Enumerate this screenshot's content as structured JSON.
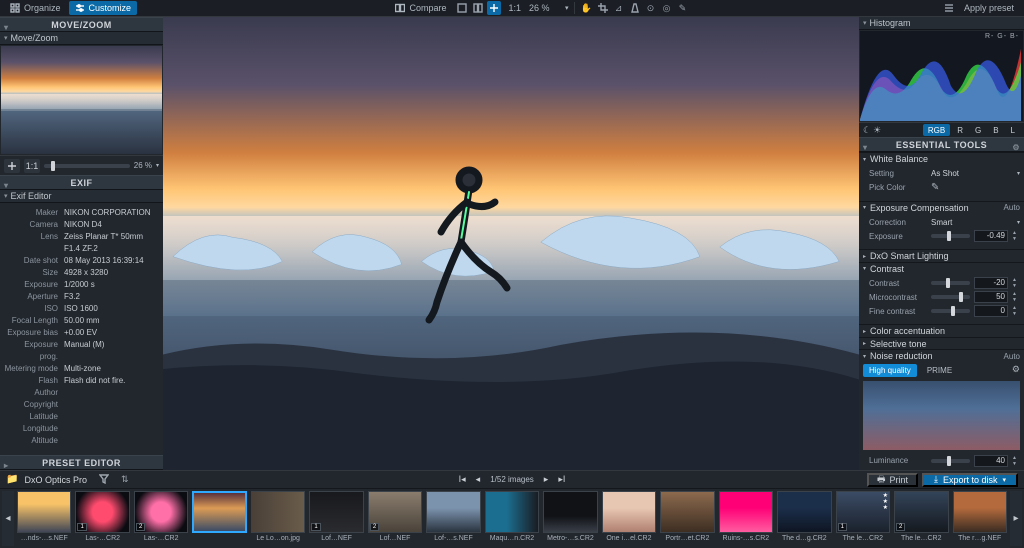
{
  "topbar": {
    "organize_label": "Organize",
    "customize_label": "Customize",
    "compare_label": "Compare",
    "zoom_fit_label": "1:1",
    "zoom_pct": "26 %",
    "apply_preset_label": "Apply preset"
  },
  "left": {
    "move_zoom_hdr": "MOVE/ZOOM",
    "zoom_row": {
      "one_to_one": "1:1",
      "pct": "26 %"
    },
    "exif_hdr": "EXIF",
    "exif_editor_hdr": "Exif Editor",
    "exif": {
      "maker_l": "Maker",
      "maker_v": "NIKON CORPORATION",
      "camera_l": "Camera",
      "camera_v": "NIKON D4",
      "lens_l": "Lens",
      "lens_v": "Zeiss Planar T* 50mm F1.4 ZF.2",
      "dateshot_l": "Date shot",
      "dateshot_v": "08 May 2013 16:39:14",
      "size_l": "Size",
      "size_v": "4928 x 3280",
      "exposure_l": "Exposure",
      "exposure_v": "1/2000 s",
      "aperture_l": "Aperture",
      "aperture_v": "F3.2",
      "iso_l": "ISO",
      "iso_v": "ISO 1600",
      "focallen_l": "Focal Length",
      "focallen_v": "50.00 mm",
      "expbias_l": "Exposure bias",
      "expbias_v": "+0.00 EV",
      "expprog_l": "Exposure prog.",
      "expprog_v": "Manual (M)",
      "metering_l": "Metering mode",
      "metering_v": "Multi-zone",
      "flash_l": "Flash",
      "flash_v": "Flash did not fire.",
      "author_l": "Author",
      "author_v": "",
      "copyright_l": "Copyright",
      "copyright_v": "",
      "latitude_l": "Latitude",
      "latitude_v": "",
      "longitude_l": "Longitude",
      "longitude_v": "",
      "altitude_l": "Altitude",
      "altitude_v": ""
    },
    "preset_editor_hdr": "PRESET EDITOR"
  },
  "right": {
    "histogram_hdr": "Histogram",
    "histo_legend": "R- G- B-",
    "channels": {
      "rgb": "RGB",
      "r": "R",
      "g": "G",
      "b": "B",
      "l": "L"
    },
    "essential_hdr": "ESSENTIAL TOOLS",
    "wb": {
      "title": "White Balance",
      "setting_l": "Setting",
      "setting_v": "As Shot",
      "pick_l": "Pick Color"
    },
    "expcomp": {
      "title": "Exposure Compensation",
      "auto": "Auto",
      "correction_l": "Correction",
      "correction_v": "Smart",
      "exposure_l": "Exposure",
      "exposure_v": "-0.49"
    },
    "smartlight": {
      "title": "DxO Smart Lighting"
    },
    "contrast": {
      "title": "Contrast",
      "contrast_l": "Contrast",
      "contrast_v": "-20",
      "micro_l": "Microcontrast",
      "micro_v": "50",
      "fine_l": "Fine contrast",
      "fine_v": "0"
    },
    "color_acc": {
      "title": "Color accentuation"
    },
    "sel_tone": {
      "title": "Selective tone"
    },
    "noise": {
      "title": "Noise reduction",
      "auto": "Auto",
      "hq": "High quality",
      "prime": "PRIME",
      "luminance_l": "Luminance",
      "luminance_v": "40"
    }
  },
  "bottom": {
    "folder_path": "DxO Optics Pro",
    "counter": "1/52 images",
    "print_label": "Print",
    "export_label": "Export to disk",
    "thumbs": [
      {
        "cap": "…nds-…s.NEF",
        "badge": "",
        "sel": false,
        "bg": "linear-gradient(#f8c368 30%,#404656 100%)"
      },
      {
        "cap": "Las-…CR2",
        "badge": "1",
        "sel": false,
        "bg": "radial-gradient(circle,#ff4b6e 30%,#0b0c12 80%)"
      },
      {
        "cap": "Las-…CR2",
        "badge": "2",
        "sel": false,
        "bg": "radial-gradient(circle,#ff6fa8 30%,#0b0c12 80%)"
      },
      {
        "cap": "",
        "badge": "",
        "sel": true,
        "bg": "linear-gradient(#58313b 0%,#dc9b55 40%,#3b4c66 100%)"
      },
      {
        "cap": "Le Lo…on.jpg",
        "badge": "",
        "sel": false,
        "bg": "linear-gradient(90deg,#4a4038,#6a5c4a)"
      },
      {
        "cap": "Lof…NEF",
        "badge": "1",
        "sel": false,
        "bg": "linear-gradient(#18191d,#2a2b2f)"
      },
      {
        "cap": "Lof…NEF",
        "badge": "2",
        "sel": false,
        "bg": "linear-gradient(#8a7d6e,#4a433a)"
      },
      {
        "cap": "Lof-…s.NEF",
        "badge": "",
        "sel": false,
        "bg": "linear-gradient(#7c93ae 40%,#2a3440 100%)"
      },
      {
        "cap": "Maqu…n.CR2",
        "badge": "",
        "sel": false,
        "bg": "linear-gradient(90deg,#1b6e8f 40%,#1a1c22 100%)"
      },
      {
        "cap": "Metro-…s.CR2",
        "badge": "",
        "sel": false,
        "bg": "linear-gradient(#101216 60%,#3a3f48 100%)"
      },
      {
        "cap": "One i…el.CR2",
        "badge": "",
        "sel": false,
        "bg": "linear-gradient(#e8c7b2 40%,#b08070 100%)"
      },
      {
        "cap": "Portr…et.CR2",
        "badge": "",
        "sel": false,
        "bg": "linear-gradient(#8c6a4e,#3d2e22)"
      },
      {
        "cap": "Ruins-…s.CR2",
        "badge": "",
        "sel": false,
        "bg": "linear-gradient(#ff0076 40%,#ff5ca0 100%)"
      },
      {
        "cap": "The d…g.CR2",
        "badge": "",
        "sel": false,
        "bg": "linear-gradient(#1b2e4a 40%,#0e1522 100%)"
      },
      {
        "cap": "The le…CR2",
        "badge": "1",
        "sel": false,
        "bg": "linear-gradient(#3b4c65,#1a212c)",
        "stars": "★★★"
      },
      {
        "cap": "The le…CR2",
        "badge": "2",
        "sel": false,
        "bg": "linear-gradient(#334459,#15191f)"
      },
      {
        "cap": "The r…g.NEF",
        "badge": "",
        "sel": false,
        "bg": "linear-gradient(#b46a3d 40%,#3a2c22 100%)"
      }
    ]
  }
}
